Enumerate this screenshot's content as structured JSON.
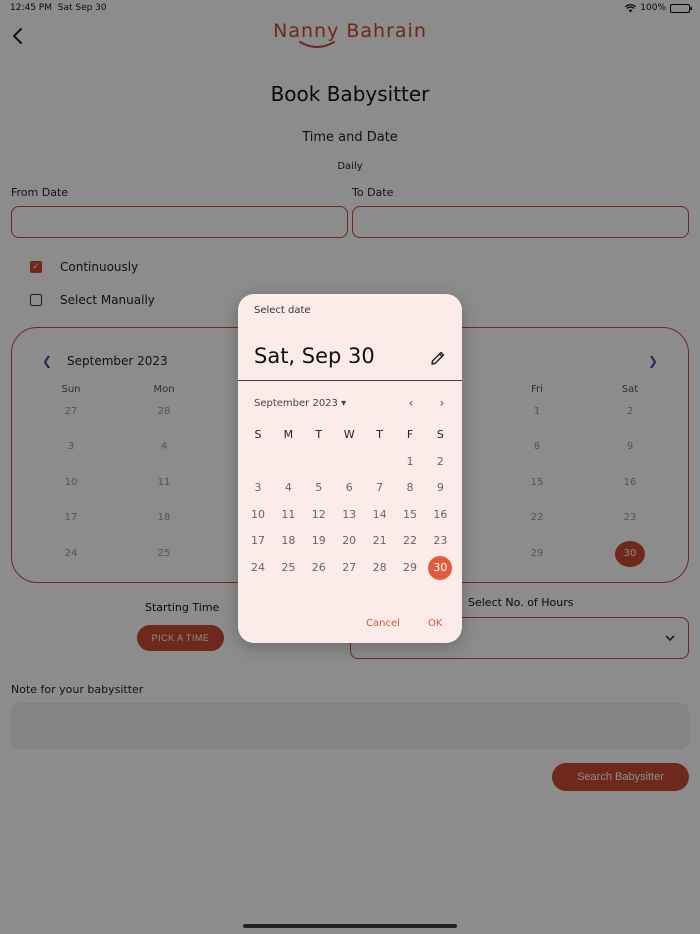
{
  "status": {
    "time": "12:45 PM",
    "date": "Sat Sep 30",
    "battery": "100%"
  },
  "header": {
    "logo": "Nanny Bahrain"
  },
  "page": {
    "title": "Book Babysitter",
    "section": "Time and Date",
    "frequency": "Daily",
    "from_label": "From Date",
    "to_label": "To Date",
    "from_value": "",
    "to_value": "",
    "opt_continuous": "Continuously",
    "opt_manual": "Select Manually",
    "start_label": "Starting Time",
    "pick_time": "PICK A TIME",
    "hours_label": "Select No. of Hours",
    "note_label": "Note for your babysitter",
    "note_placeholder": "",
    "search_button": "Search Babysitter"
  },
  "calendar": {
    "month": "September 2023",
    "weekdays": [
      "Sun",
      "Mon",
      "",
      "",
      "",
      "Fri",
      "Sat"
    ],
    "rows": [
      [
        "27",
        "28",
        "1",
        "2"
      ],
      [
        "3",
        "4",
        "8",
        "9"
      ],
      [
        "10",
        "11",
        "15",
        "16"
      ],
      [
        "17",
        "18",
        "22",
        "23"
      ],
      [
        "24",
        "25",
        "29",
        "30"
      ]
    ],
    "selected": "30"
  },
  "dialog": {
    "header": "Select date",
    "selected_date": "Sat, Sep 30",
    "month_label": "September 2023",
    "weekdays": [
      "S",
      "M",
      "T",
      "W",
      "T",
      "F",
      "S"
    ],
    "days": [
      [
        "",
        "",
        "",
        "",
        "",
        "1",
        "2"
      ],
      [
        "3",
        "4",
        "5",
        "6",
        "7",
        "8",
        "9"
      ],
      [
        "10",
        "11",
        "12",
        "13",
        "14",
        "15",
        "16"
      ],
      [
        "17",
        "18",
        "19",
        "20",
        "21",
        "22",
        "23"
      ],
      [
        "24",
        "25",
        "26",
        "27",
        "28",
        "29",
        "30"
      ]
    ],
    "selected_day": "30",
    "cancel": "Cancel",
    "ok": "OK"
  },
  "colors": {
    "accent": "#c94a33",
    "selected": "#e25a40",
    "dialog_bg": "#fcece9"
  }
}
